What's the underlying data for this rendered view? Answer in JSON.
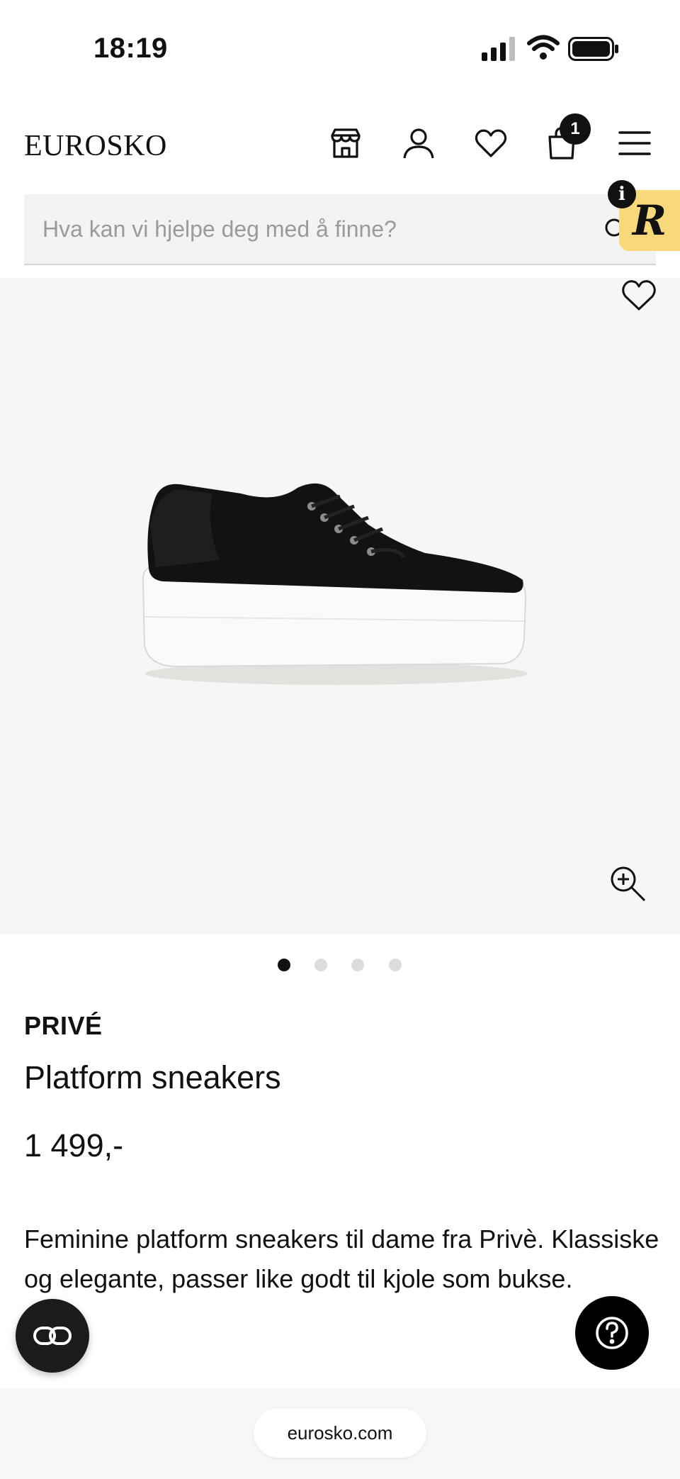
{
  "status_bar": {
    "time": "18:19"
  },
  "header": {
    "logo": "EUROSKO",
    "cart_count": "1"
  },
  "search": {
    "placeholder": "Hva kan vi hjelpe deg med å finne?"
  },
  "widget": {
    "letter": "R",
    "info_label": "i"
  },
  "product": {
    "brand": "PRIVÉ",
    "title": "Platform sneakers",
    "price": "1 499,-",
    "description": "Feminine platform sneakers til dame fra Privè. Klassiske og elegante, passer like godt til kjole som bukse."
  },
  "gallery": {
    "image_count": 4,
    "active_index": 0
  },
  "browser": {
    "url": "eurosko.com"
  },
  "icons": {
    "store": "store-icon",
    "account": "user-icon",
    "wishlist": "heart-icon",
    "cart": "shopping-bag-icon",
    "menu": "hamburger-menu-icon",
    "search": "search-icon",
    "zoom": "zoom-in-icon",
    "help": "question-icon",
    "link": "link-icon"
  }
}
